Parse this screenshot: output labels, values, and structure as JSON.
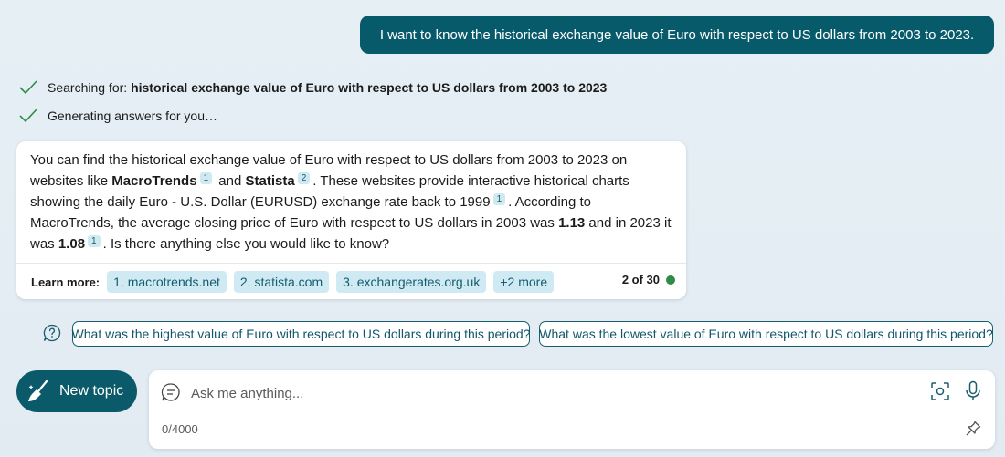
{
  "user_message": "I want to know the historical exchange value of Euro with respect to US dollars from 2003 to 2023.",
  "status": {
    "searching_prefix": "Searching for: ",
    "searching_query": "historical exchange value of Euro with respect to US dollars from 2003 to 2023",
    "generating": "Generating answers for you…"
  },
  "answer": {
    "part1": "You can find the historical exchange value of Euro with respect to US dollars from 2003 to 2023 on websites like ",
    "site1": "MacroTrends",
    "cite1": "1",
    "and": " and ",
    "site2": "Statista",
    "cite2": "2",
    "part2": ". These websites provide interactive historical charts showing the daily Euro - U.S. Dollar (EURUSD) exchange rate back to 1999",
    "cite3": "1",
    "part3": ". According to MacroTrends, the average closing price of Euro with respect to US dollars in 2003 was ",
    "value2003": "1.13",
    "part4": " and in 2023 it was ",
    "value2023": "1.08",
    "cite4": "1",
    "part5": ". Is there anything else you would like to know?"
  },
  "learn_more": {
    "label": "Learn more:",
    "sources": [
      "1. macrotrends.net",
      "2. statista.com",
      "3. exchangerates.org.uk"
    ],
    "more": "+2 more",
    "counter": "2 of 30"
  },
  "suggestions": [
    "What was the highest value of Euro with respect to US dollars during this period?",
    "What was the lowest value of Euro with respect to US dollars during this period?"
  ],
  "new_topic_label": "New topic",
  "input": {
    "placeholder": "Ask me anything...",
    "char_count": "0/4000"
  },
  "colors": {
    "accent": "#075a6a",
    "chip_bg": "#cfeaf3",
    "status_check": "#2e8b4a"
  }
}
